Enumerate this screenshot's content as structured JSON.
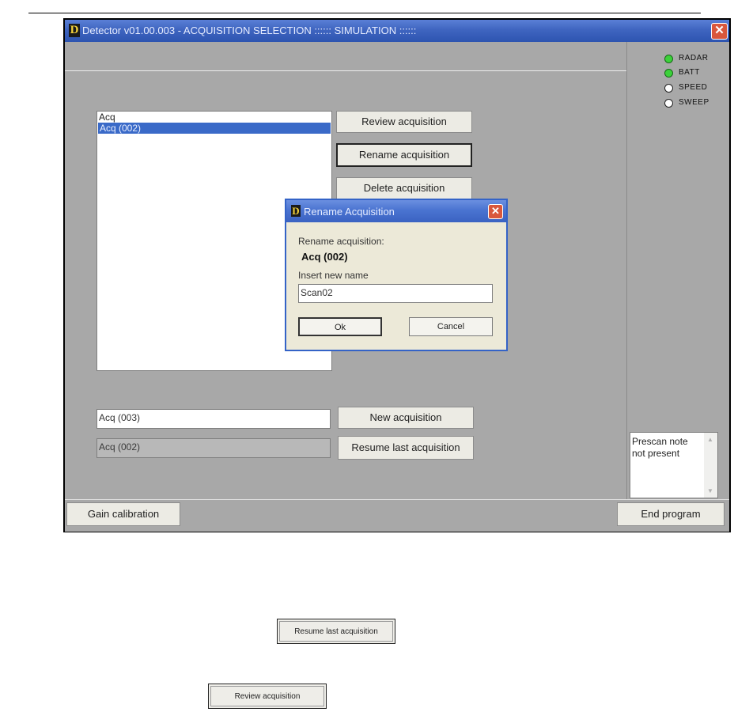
{
  "window": {
    "title": "Detector v01.00.003 - ACQUISITION SELECTION :::::: SIMULATION ::::::",
    "logo_letter": "D",
    "close_glyph": "✕"
  },
  "acquisitions": {
    "items": [
      {
        "label": "Acq",
        "selected": false
      },
      {
        "label": "Acq (002)",
        "selected": true
      }
    ]
  },
  "actions": {
    "review": "Review acquisition",
    "rename": "Rename acquisition",
    "delete": "Delete acquisition",
    "new": "New acquisition",
    "resume": "Resume last acquisition"
  },
  "fields": {
    "new_name": "Acq (003)",
    "last_acq": "Acq (002)"
  },
  "indicators": [
    {
      "label": "RADAR",
      "on": true,
      "color": "#3cd13a"
    },
    {
      "label": "BATT",
      "on": true,
      "color": "#3cd13a"
    },
    {
      "label": "SPEED",
      "on": false
    },
    {
      "label": "SWEEP",
      "on": false
    }
  ],
  "note": {
    "text": "Prescan note not present"
  },
  "bottom": {
    "gain": "Gain calibration",
    "end": "End program"
  },
  "dialog": {
    "title": "Rename Acquisition",
    "logo_letter": "D",
    "close_glyph": "✕",
    "prompt": "Rename acquisition:",
    "current_name": "Acq (002)",
    "insert_label": "Insert new name",
    "new_name_value": "Scan02",
    "ok": "Ok",
    "cancel": "Cancel"
  },
  "standalone_buttons": {
    "resume": "Resume last acquisition",
    "review": "Review acquisition"
  },
  "colors": {
    "titlebar": "#3f65c0",
    "window_bg": "#a8a8a8",
    "selection": "#3a6ac8",
    "close_button": "#d9573c",
    "indicator_on": "#3cd13a"
  }
}
